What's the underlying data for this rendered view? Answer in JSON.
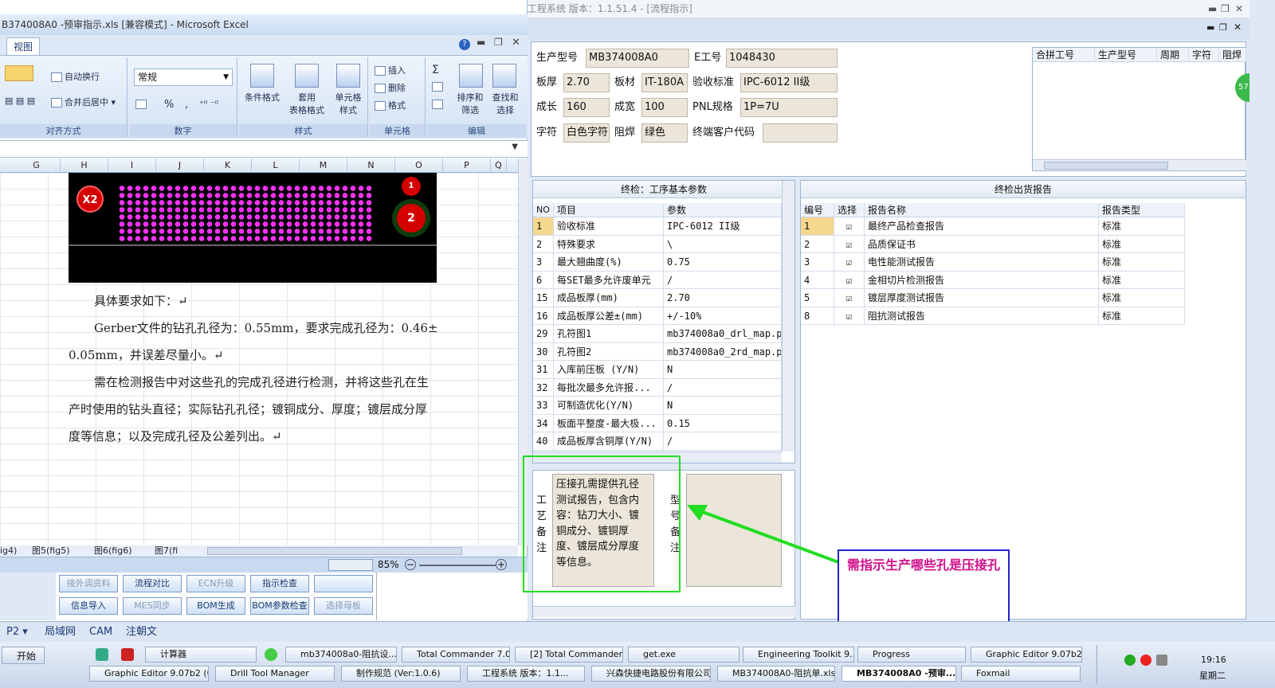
{
  "excel": {
    "title": "B374008A0 -预审指示.xls  [兼容模式] - Microsoft Excel",
    "tab_view": "视图",
    "ribbon": {
      "wrap_text": "自动换行",
      "merge_center": "合并后居中",
      "number_format": "常规",
      "percent": "%",
      "comma": ",",
      "cond_format": "条件格式",
      "table_format": "套用\n表格格式",
      "cell_style": "单元格\n样式",
      "insert": "插入",
      "delete": "删除",
      "format": "格式",
      "sort_filter": "排序和\n筛选",
      "find_select": "查找和\n选择",
      "sigma": "Σ",
      "groups": [
        "对齐方式",
        "数字",
        "样式",
        "单元格",
        "编辑"
      ]
    },
    "columns": [
      "G",
      "H",
      "I",
      "J",
      "K",
      "L",
      "M",
      "N",
      "O",
      "P",
      "Q"
    ],
    "pcb": {
      "x2": "X2",
      "c1": "1",
      "c2": "2"
    },
    "doc": {
      "line1": "具体要求如下：↵",
      "line2": "Gerber文件的钻孔孔径为：0.55mm，要求完成孔径为：0.46±",
      "line3": "0.05mm，并误差尽量小。↵",
      "line4": "需在检测报告中对这些孔的完成孔径进行检测，并将这些孔在生",
      "line5": "产时使用的钻头直径；实际钻孔孔径；镀铜成分、厚度；镀层成分厚",
      "line6": "度等信息；以及完成孔径及公差列出。↵"
    },
    "sheet_tabs": [
      "ig4)",
      "图5(fig5)",
      "图6(fig6)",
      "图7(fi"
    ],
    "zoom": "85%",
    "tools": {
      "row1": [
        "接外调资料",
        "流程对比",
        "ECN升级",
        "指示检查",
        ""
      ],
      "row2": [
        "信息导入",
        "MES同步",
        "BOM生成",
        "BOM参数检查",
        "选择母板"
      ]
    }
  },
  "app": {
    "title": "工程系统   版本：1.1.51.4 - [流程指示]",
    "form": {
      "model_label": "生产型号",
      "model": "MB374008A0",
      "e_label": "E工号",
      "e_no": "1048430",
      "thick_label": "板厚",
      "thick": "2.70",
      "material_label": "板材",
      "material": "IT-180A",
      "standard_label": "验收标准",
      "standard": "IPC-6012 II级",
      "len_label": "成长",
      "len": "160",
      "width_label": "成宽",
      "width": "100",
      "pnl_label": "PNL规格",
      "pnl": "1P=7U",
      "char_label": "字符",
      "char": "白色字符",
      "mask_label": "阻焊",
      "mask": "绿色",
      "customer_label": "终端客户代码",
      "customer": ""
    },
    "combine_headers": [
      "合拼工号",
      "生产型号",
      "周期",
      "字符",
      "阻焊"
    ],
    "params": {
      "title": "终检：工序基本参数",
      "headers": [
        "NO",
        "项目",
        "参数"
      ],
      "rows": [
        [
          "1",
          "验收标准",
          "IPC-6012 II级"
        ],
        [
          "2",
          "特殊要求",
          "\\"
        ],
        [
          "3",
          "最大翘曲度(%)",
          "0.75"
        ],
        [
          "6",
          "每SET最多允许废单元",
          "/"
        ],
        [
          "15",
          "成品板厚(mm)",
          "2.70"
        ],
        [
          "16",
          "成品板厚公差±(mm)",
          "+/-10%"
        ],
        [
          "29",
          "孔符图1",
          "mb374008a0_drl_map.p"
        ],
        [
          "30",
          "孔符图2",
          "mb374008a0_2rd_map.p"
        ],
        [
          "31",
          "入库前压板 (Y/N)",
          "N"
        ],
        [
          "32",
          "每批次最多允许报...",
          "/"
        ],
        [
          "33",
          "可制造优化(Y/N)",
          "N"
        ],
        [
          "34",
          "板面平整度-最大极...",
          "0.15"
        ],
        [
          "40",
          "成品板厚含铜厚(Y/N)",
          "/"
        ]
      ]
    },
    "reports": {
      "title": "终检出货报告",
      "headers": [
        "编号",
        "选择",
        "报告名称",
        "报告类型"
      ],
      "rows": [
        [
          "1",
          "☑",
          "最终产品检查报告",
          "标准"
        ],
        [
          "2",
          "☑",
          "品质保证书",
          "标准"
        ],
        [
          "3",
          "☑",
          "电性能测试报告",
          "标准"
        ],
        [
          "4",
          "☑",
          "金相切片检测报告",
          "标准"
        ],
        [
          "5",
          "☑",
          "镀层厚度测试报告",
          "标准"
        ],
        [
          "8",
          "☑",
          "阻抗测试报告",
          "标准"
        ]
      ]
    },
    "remark_label": "工艺备注",
    "remark_text": "压接孔需提供孔径测试报告，包含内容：钻刀大小、镀铜成分、镀铜厚度、镀层成分厚度等信息。",
    "type_remark_label": "型号备注",
    "badge": "57"
  },
  "annotation": "需指示生产哪些孔是压接孔",
  "bottom_tabs": [
    "P2",
    "局域网",
    "CAM",
    "注朝文"
  ],
  "taskbar": {
    "start": "开始",
    "row1": [
      "计算器",
      "mb374008a0-阻抗设...",
      "Total Commander 7.0...",
      "[2] Total Commander ...",
      "get.exe",
      "Engineering Toolkit 9....",
      "Progress",
      "Graphic Editor 9.07b2..."
    ],
    "row2": [
      "Graphic Editor 9.07b2 (0...",
      "Drill Tool Manager",
      "制作规范 (Ver:1.0.6)",
      "工程系统  版本：1.1...",
      "兴森快捷电路股份有限公司",
      "MB374008A0-阻抗单.xls",
      "MB374008A0 -预审...",
      "Foxmail"
    ],
    "time": "19:16",
    "day": "星期二"
  },
  "colors": {
    "accent": "#1e3b73",
    "annotation_border": "#2222cc",
    "annotation_text": "#d0108a",
    "arrow": "#22dd22"
  }
}
